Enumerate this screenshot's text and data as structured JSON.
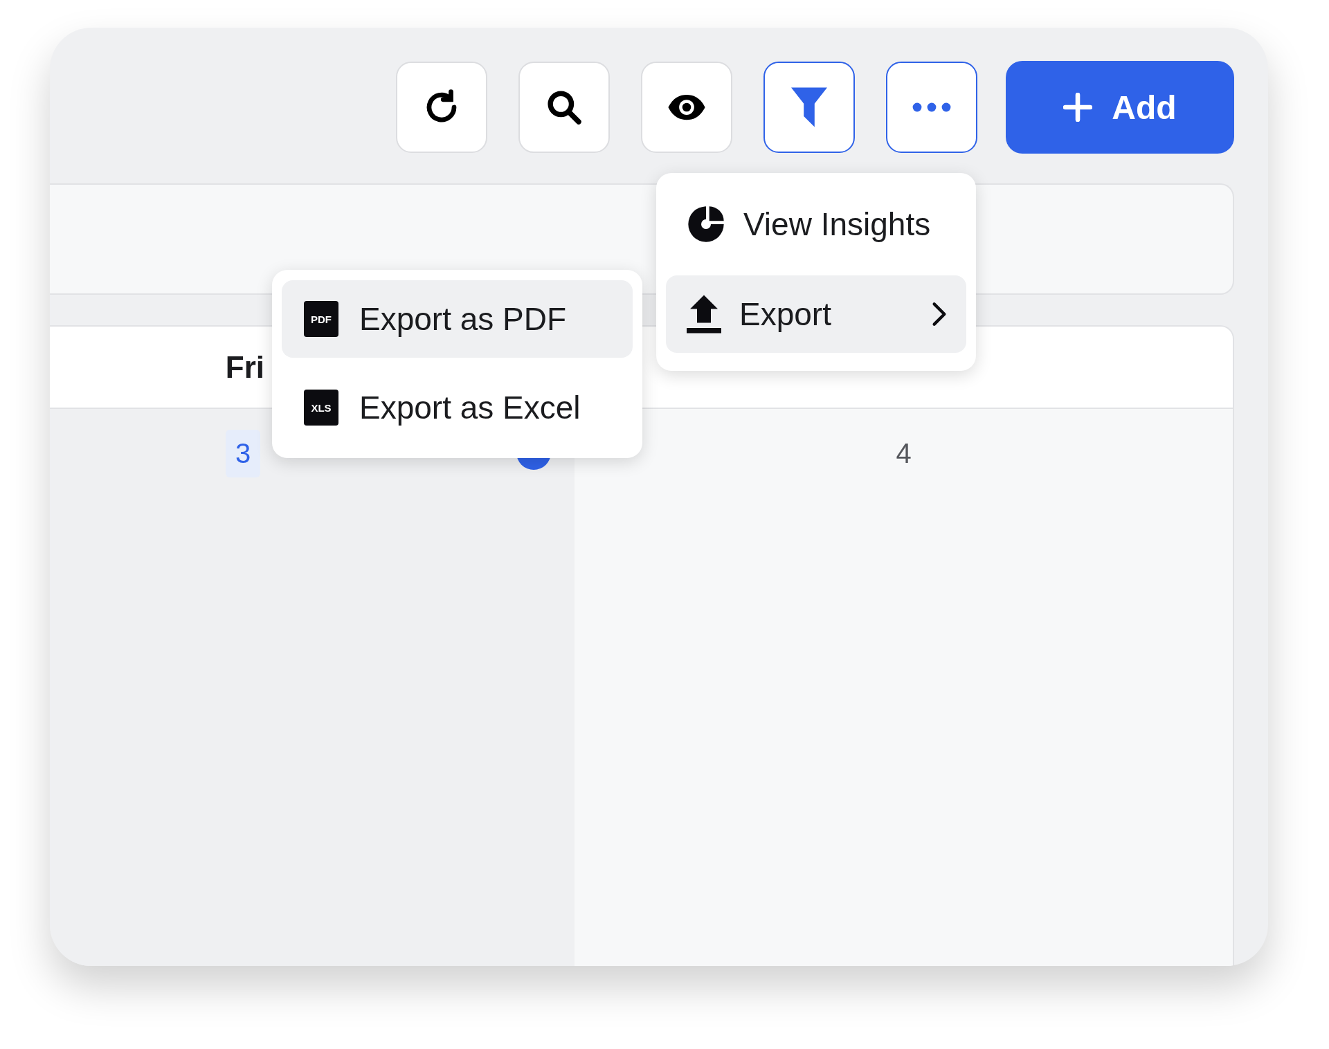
{
  "toolbar": {
    "buttons": [
      {
        "kind": "refresh",
        "active": false
      },
      {
        "kind": "search",
        "active": false
      },
      {
        "kind": "eye",
        "active": false
      },
      {
        "kind": "filter",
        "active": true
      },
      {
        "kind": "more",
        "active": true
      }
    ],
    "add_button": {
      "label": "Add"
    }
  },
  "calendar": {
    "days": [
      {
        "label": "Fri",
        "date": "3",
        "today": true
      },
      {
        "date": "4",
        "today": false
      }
    ]
  },
  "menu": {
    "items": [
      {
        "kind": "insights",
        "label": "View Insights",
        "selected": false,
        "submenu": false
      },
      {
        "kind": "export",
        "label": "Export",
        "selected": true,
        "submenu": true
      }
    ]
  },
  "submenu": {
    "items": [
      {
        "badge": "PDF",
        "label": "Export as PDF",
        "selected": true
      },
      {
        "badge": "XLS",
        "label": "Export as Excel",
        "selected": false
      }
    ]
  }
}
